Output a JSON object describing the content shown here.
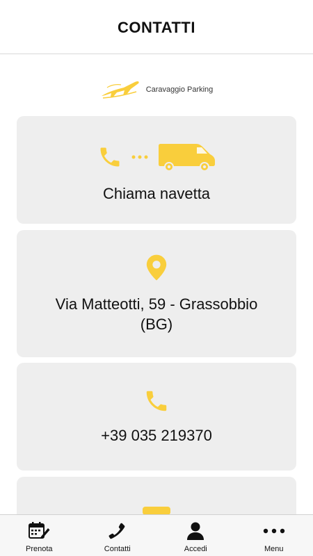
{
  "header": {
    "title": "CONTATTI"
  },
  "logo": {
    "text": "Caravaggio Parking"
  },
  "cards": {
    "shuttle": {
      "label": "Chiama navetta",
      "icons": [
        "phone-icon",
        "dots-icon",
        "van-icon"
      ]
    },
    "address": {
      "line1": "Via Matteotti, 59 - Grassobbio",
      "line2": "(BG)",
      "icon": "location-pin-icon"
    },
    "phone": {
      "label": "+39 035 219370",
      "icon": "phone-icon"
    },
    "extra": {
      "icon": "partial-icon"
    }
  },
  "tabbar": {
    "items": [
      {
        "label": "Prenota",
        "icon": "calendar-edit-icon"
      },
      {
        "label": "Contatti",
        "icon": "phone-icon"
      },
      {
        "label": "Accedi",
        "icon": "user-icon"
      },
      {
        "label": "Menu",
        "icon": "more-dots-icon"
      }
    ]
  },
  "colors": {
    "accent": "#F9CE3C",
    "card_bg": "#EEEEEE",
    "text": "#111111"
  }
}
